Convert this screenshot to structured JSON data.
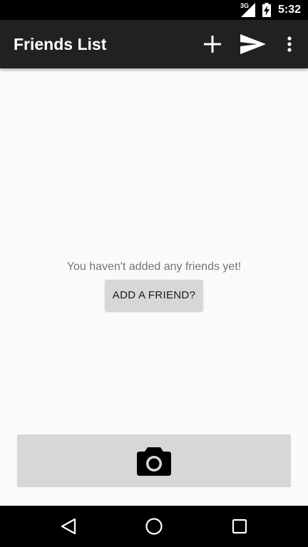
{
  "status_bar": {
    "network": "3G",
    "time": "5:32"
  },
  "app_bar": {
    "title": "Friends List",
    "actions": [
      "add-icon",
      "send-icon",
      "overflow-menu-icon"
    ]
  },
  "empty_state": {
    "message": "You haven't added any friends yet!",
    "button_label": "ADD A FRIEND?"
  },
  "camera_button": {
    "icon": "camera-icon"
  },
  "nav_bar": {
    "buttons": [
      "back-icon",
      "home-icon",
      "recents-icon"
    ]
  },
  "colors": {
    "status_bar": "#000000",
    "app_bar": "#212121",
    "background": "#fafafa",
    "button": "#d6d7d7",
    "message_text": "#757575"
  }
}
